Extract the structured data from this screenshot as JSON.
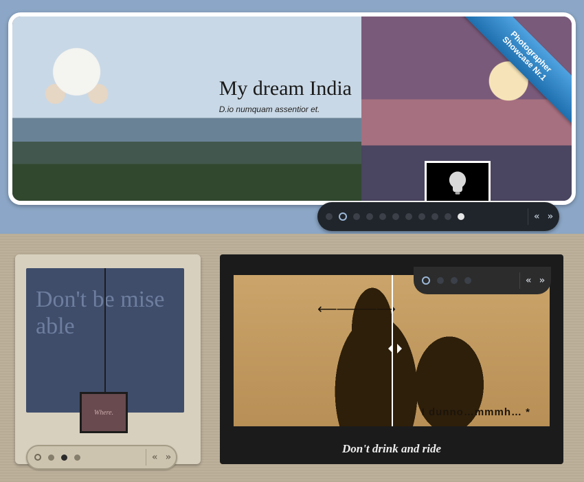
{
  "top": {
    "ribbon_line1": "Photographer",
    "ribbon_line2": "Showcase Nr.1",
    "title": "My dream India",
    "subtitle": "D.io numquam assentior et.",
    "thumb_icon": "lightbulb",
    "dot_count": 11,
    "ringed_index": 1,
    "active_index": 10,
    "prev": "«",
    "next": "»"
  },
  "left": {
    "quote": "Don't be mise  able",
    "tag": "Where.",
    "dot_count": 4,
    "ringed_index": 0,
    "dark_index": 2,
    "prev": "«",
    "next": "»"
  },
  "right": {
    "arrow_deco": "⟵────⟶",
    "bubble": "I dunno…mmmh…  *",
    "caption": "Don't drink and ride",
    "dot_count": 4,
    "ringed_index": 0,
    "prev": "«",
    "next": "»"
  }
}
